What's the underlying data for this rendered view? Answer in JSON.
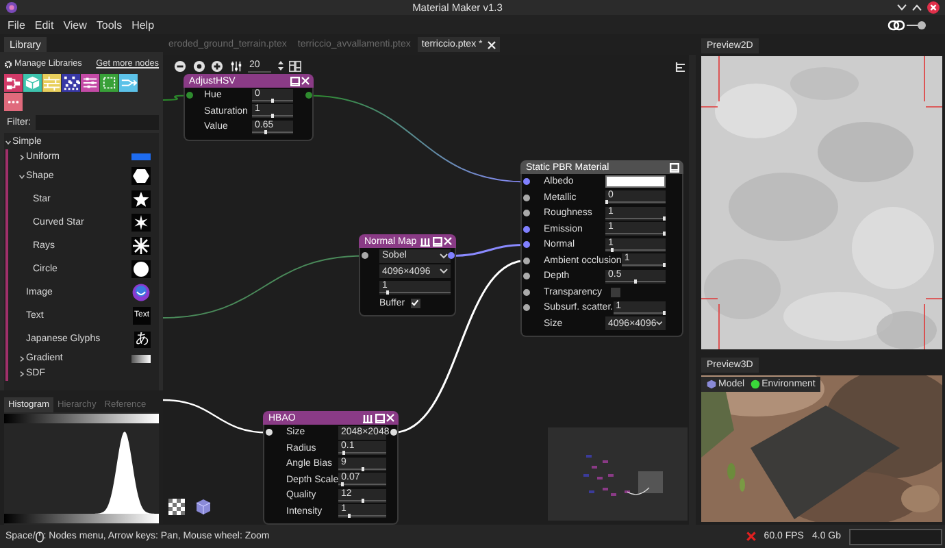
{
  "window": {
    "title": "Material Maker v1.3"
  },
  "menu": [
    "File",
    "Edit",
    "View",
    "Tools",
    "Help"
  ],
  "library": {
    "tab": "Library",
    "manage": "Manage Libraries",
    "more": "Get more nodes",
    "categories": [
      {
        "kind": "flow",
        "color": "#d23a68"
      },
      {
        "kind": "cube",
        "color": "#3ec4ae"
      },
      {
        "kind": "bricks",
        "color": "#e8cf5c"
      },
      {
        "kind": "noise",
        "color": "#3838a6"
      },
      {
        "kind": "sliders",
        "color": "#c44aa6"
      },
      {
        "kind": "frame",
        "color": "#38a038"
      },
      {
        "kind": "arrows",
        "color": "#5cc2e8"
      },
      {
        "kind": "dots",
        "color": "#e06a7c"
      }
    ],
    "filter_label": "Filter:",
    "tree": [
      {
        "label": "Simple",
        "expanded": true,
        "children": [
          {
            "label": "Uniform",
            "expanded": false,
            "kind": "uniform"
          },
          {
            "label": "Shape",
            "expanded": true,
            "kind": "shape",
            "children": [
              {
                "label": "Star",
                "kind": "star"
              },
              {
                "label": "Curved Star",
                "kind": "curved-star"
              },
              {
                "label": "Rays",
                "kind": "rays"
              },
              {
                "label": "Circle",
                "kind": "circle"
              }
            ]
          },
          {
            "label": "Image"
          },
          {
            "label": "Text",
            "kind": "text",
            "thumb_text": "Text"
          },
          {
            "label": "Japanese Glyphs",
            "kind": "glyph",
            "thumb_text": "あ"
          },
          {
            "label": "Gradient",
            "expanded": false,
            "kind": "gradient"
          },
          {
            "label": "SDF",
            "expanded": false
          }
        ]
      }
    ]
  },
  "histogram_tabs": [
    {
      "label": "Histogram",
      "selected": true
    },
    {
      "label": "Hierarchy",
      "selected": false
    },
    {
      "label": "Reference",
      "selected": false
    }
  ],
  "document_tabs": [
    {
      "label": "eroded_ground_terrain.ptex",
      "selected": false,
      "closable": false
    },
    {
      "label": "terriccio_avvallamenti.ptex",
      "selected": false,
      "closable": false
    },
    {
      "label": "terriccio.ptex *",
      "selected": true,
      "closable": true
    }
  ],
  "graph": {
    "zoom": "20",
    "nodes": [
      {
        "title": "AdjustHSV",
        "kind": "filter",
        "buttons": [
          {
            "kind": "minimize"
          },
          {
            "kind": "close"
          }
        ],
        "rows": [
          {
            "kind": "number",
            "label": "Hue",
            "value": "0",
            "level": 0.5,
            "in_port": {
              "color": "#2e8b2e"
            },
            "out_port": {
              "color": "#2e8b2e"
            }
          },
          {
            "kind": "number",
            "label": "Saturation",
            "value": "1",
            "level": 0.5
          },
          {
            "kind": "number",
            "label": "Value",
            "value": "0.65",
            "level": 0.33
          }
        ]
      },
      {
        "title": "Static PBR Material",
        "kind": "material",
        "buttons": [
          {
            "kind": "minimize"
          }
        ],
        "rows": [
          {
            "kind": "color",
            "label": "Albedo",
            "color": "#ffffff",
            "in_port": {
              "color": "#8080ff"
            }
          },
          {
            "kind": "number",
            "label": "Metallic",
            "value": "0",
            "level": 0,
            "in_port": {
              "color": "#aaaaaa"
            }
          },
          {
            "kind": "number",
            "label": "Roughness",
            "value": "1",
            "level": 1,
            "in_port": {
              "color": "#aaaaaa"
            }
          },
          {
            "kind": "number",
            "label": "Emission",
            "value": "1",
            "level": 1,
            "in_port": {
              "color": "#8080ff"
            }
          },
          {
            "kind": "number",
            "label": "Normal",
            "value": "1",
            "level": 0.1,
            "in_port": {
              "color": "#8080ff"
            }
          },
          {
            "kind": "number",
            "label": "Ambient occlusion",
            "value": "1",
            "level": 1,
            "in_port": {
              "color": "#aaaaaa"
            }
          },
          {
            "kind": "number",
            "label": "Depth",
            "value": "0.5",
            "level": 0.5,
            "in_port": {
              "color": "#aaaaaa"
            }
          },
          {
            "kind": "checkbox",
            "label": "Transparency",
            "checked": false,
            "in_port": {
              "color": "#aaaaaa"
            }
          },
          {
            "kind": "number",
            "label": "Subsurf. scatter.",
            "value": "1",
            "level": 1,
            "in_port": {
              "color": "#aaaaaa"
            }
          },
          {
            "kind": "select",
            "label": "Size",
            "value": "4096×4096"
          }
        ]
      },
      {
        "title": "Normal Map",
        "kind": "filter",
        "buttons": [
          {
            "kind": "buffer"
          },
          {
            "kind": "minimize"
          },
          {
            "kind": "close"
          }
        ],
        "rows": [
          {
            "kind": "select",
            "value": "Sobel",
            "in_port": {
              "color": "#aaaaaa"
            },
            "out_port": {
              "color": "#8080ff"
            }
          },
          {
            "kind": "select",
            "value": "4096×4096"
          },
          {
            "kind": "number",
            "value": "1",
            "level": 0.1
          },
          {
            "kind": "checkbox",
            "label": "Buffer",
            "checked": true
          }
        ]
      },
      {
        "title": "HBAO",
        "kind": "filter",
        "buttons": [
          {
            "kind": "buffer"
          },
          {
            "kind": "minimize"
          },
          {
            "kind": "close"
          }
        ],
        "rows": [
          {
            "kind": "select",
            "label": "Size",
            "value": "2048×2048",
            "in_port": {
              "color": "#dddddd"
            },
            "out_port": {
              "color": "#dddddd"
            }
          },
          {
            "kind": "number",
            "label": "Radius",
            "value": "0.1",
            "level": 0.1
          },
          {
            "kind": "number",
            "label": "Angle Bias",
            "value": "9",
            "level": 0.5
          },
          {
            "kind": "number",
            "label": "Depth Scale",
            "value": "0.07",
            "level": 0.07
          },
          {
            "kind": "number",
            "label": "Quality",
            "value": "12",
            "level": 0.5
          },
          {
            "kind": "number",
            "label": "Intensity",
            "value": "1",
            "level": 0.2
          }
        ]
      }
    ]
  },
  "previews": {
    "tab_2d": "Preview2D",
    "tab_3d": "Preview3D",
    "buttons": [
      {
        "kind": "model",
        "label": "Model"
      },
      {
        "kind": "environment",
        "label": "Environment"
      }
    ]
  },
  "status_bar": {
    "hint_before": "Space/",
    "hint_after": ": Nodes menu, Arrow keys: Pan, Mouse wheel: Zoom",
    "fps": "60.0 FPS",
    "memory": "4.0 Gb"
  }
}
